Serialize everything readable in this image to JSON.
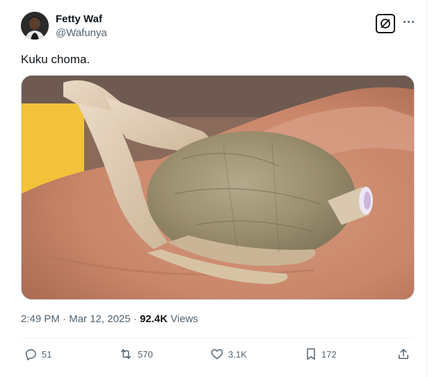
{
  "author": {
    "display_name": "Fetty Waf",
    "handle": "@Wafunya",
    "avatar_icon": "avatar-photo"
  },
  "tweet": {
    "text": "Kuku choma.",
    "media_description": "photo of a roasted-chicken-shaped object held on a palm",
    "time": "2:49 PM",
    "separator": "·",
    "date": "Mar 12, 2025",
    "views_count": "92.4K",
    "views_label": "Views"
  },
  "header_icons": {
    "grok": "grok-icon",
    "more": "more-icon"
  },
  "actions": {
    "replies": {
      "icon": "reply-icon",
      "count": "51"
    },
    "reposts": {
      "icon": "repost-icon",
      "count": "570"
    },
    "likes": {
      "icon": "heart-icon",
      "count": "3.1K"
    },
    "bookmarks": {
      "icon": "bookmark-icon",
      "count": "172"
    },
    "share": {
      "icon": "share-icon"
    }
  },
  "colors": {
    "text_primary": "#0f1419",
    "text_secondary": "#536471",
    "border": "#cfd9de"
  }
}
